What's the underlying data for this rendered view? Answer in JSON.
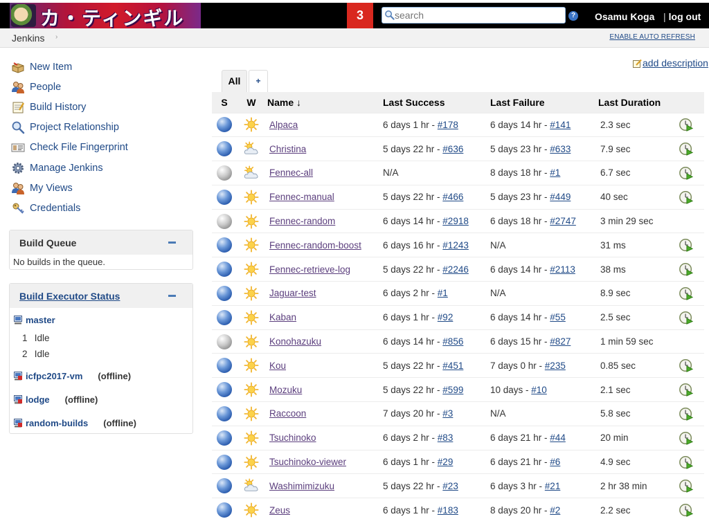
{
  "header": {
    "logo_text": "カ・ティンギル",
    "notification_count": "3",
    "search_placeholder": "search",
    "user_name": "Osamu Koga",
    "logout_label": "log out"
  },
  "breadcrumb": {
    "root": "Jenkins",
    "auto_refresh": "ENABLE AUTO REFRESH"
  },
  "tasks": [
    {
      "label": "New Item",
      "icon": "new-item-icon"
    },
    {
      "label": "People",
      "icon": "people-icon"
    },
    {
      "label": "Build History",
      "icon": "notepad-icon"
    },
    {
      "label": "Project Relationship",
      "icon": "search-icon"
    },
    {
      "label": "Check File Fingerprint",
      "icon": "fingerprint-icon"
    },
    {
      "label": "Manage Jenkins",
      "icon": "gear-icon"
    },
    {
      "label": "My Views",
      "icon": "people-icon"
    },
    {
      "label": "Credentials",
      "icon": "credentials-icon"
    }
  ],
  "build_queue": {
    "title": "Build Queue",
    "empty_text": "No builds in the queue."
  },
  "executors": {
    "title": "Build Executor Status",
    "master": {
      "name": "master",
      "slots": [
        {
          "num": "1",
          "state": "Idle"
        },
        {
          "num": "2",
          "state": "Idle"
        }
      ]
    },
    "nodes": [
      {
        "name": "icfpc2017-vm",
        "status": "(offline)"
      },
      {
        "name": "lodge",
        "status": "(offline)"
      },
      {
        "name": "random-builds",
        "status": "(offline)"
      }
    ]
  },
  "add_description": "add description",
  "view_tabs": [
    {
      "label": "All",
      "active": true
    },
    {
      "label": "+",
      "active": false
    }
  ],
  "columns": {
    "s": "S",
    "w": "W",
    "name": "Name ↓",
    "last_success": "Last Success",
    "last_failure": "Last Failure",
    "last_duration": "Last Duration"
  },
  "colors": {
    "link": "#204a87",
    "job_link": "#5b3e7d",
    "counter_bg": "#d9281f"
  },
  "jobs": [
    {
      "name": "Alpaca",
      "status": "blue",
      "weather": "sunny",
      "success": "6 days 1 hr - ",
      "success_build": "#178",
      "failure": "6 days 14 hr - ",
      "failure_build": "#141",
      "duration": "2.3 sec",
      "schedule": true
    },
    {
      "name": "Christina",
      "status": "blue",
      "weather": "partly-cloudy",
      "success": "5 days 22 hr - ",
      "success_build": "#636",
      "failure": "5 days 23 hr - ",
      "failure_build": "#633",
      "duration": "7.9 sec",
      "schedule": true
    },
    {
      "name": "Fennec-all",
      "status": "grey",
      "weather": "partly-cloudy",
      "success": "N/A",
      "success_build": "",
      "failure": "8 days 18 hr - ",
      "failure_build": "#1",
      "duration": "6.7 sec",
      "schedule": true
    },
    {
      "name": "Fennec-manual",
      "status": "blue",
      "weather": "sunny",
      "success": "5 days 22 hr - ",
      "success_build": "#466",
      "failure": "5 days 23 hr - ",
      "failure_build": "#449",
      "duration": "40 sec",
      "schedule": true
    },
    {
      "name": "Fennec-random",
      "status": "grey",
      "weather": "sunny",
      "success": "6 days 14 hr - ",
      "success_build": "#2918",
      "failure": "6 days 18 hr - ",
      "failure_build": "#2747",
      "duration": "3 min 29 sec",
      "schedule": false
    },
    {
      "name": "Fennec-random-boost",
      "status": "blue",
      "weather": "sunny",
      "success": "6 days 16 hr - ",
      "success_build": "#1243",
      "failure": "N/A",
      "failure_build": "",
      "duration": "31 ms",
      "schedule": true
    },
    {
      "name": "Fennec-retrieve-log",
      "status": "blue",
      "weather": "sunny",
      "success": "5 days 22 hr - ",
      "success_build": "#2246",
      "failure": "6 days 14 hr - ",
      "failure_build": "#2113",
      "duration": "38 ms",
      "schedule": true
    },
    {
      "name": "Jaguar-test",
      "status": "blue",
      "weather": "sunny",
      "success": "6 days 2 hr - ",
      "success_build": "#1",
      "failure": "N/A",
      "failure_build": "",
      "duration": "8.9 sec",
      "schedule": true
    },
    {
      "name": "Kaban",
      "status": "blue",
      "weather": "sunny",
      "success": "6 days 1 hr - ",
      "success_build": "#92",
      "failure": "6 days 14 hr - ",
      "failure_build": "#55",
      "duration": "2.5 sec",
      "schedule": true
    },
    {
      "name": "Konohazuku",
      "status": "grey",
      "weather": "sunny",
      "success": "6 days 14 hr - ",
      "success_build": "#856",
      "failure": "6 days 15 hr - ",
      "failure_build": "#827",
      "duration": "1 min 59 sec",
      "schedule": false
    },
    {
      "name": "Kou",
      "status": "blue",
      "weather": "sunny",
      "success": "5 days 22 hr - ",
      "success_build": "#451",
      "failure": "7 days 0 hr - ",
      "failure_build": "#235",
      "duration": "0.85 sec",
      "schedule": true
    },
    {
      "name": "Mozuku",
      "status": "blue",
      "weather": "sunny",
      "success": "5 days 22 hr - ",
      "success_build": "#599",
      "failure": "10 days - ",
      "failure_build": "#10",
      "duration": "2.1 sec",
      "schedule": true
    },
    {
      "name": "Raccoon",
      "status": "blue",
      "weather": "sunny",
      "success": "7 days 20 hr - ",
      "success_build": "#3",
      "failure": "N/A",
      "failure_build": "",
      "duration": "5.8 sec",
      "schedule": true
    },
    {
      "name": "Tsuchinoko",
      "status": "blue",
      "weather": "sunny",
      "success": "6 days 2 hr - ",
      "success_build": "#83",
      "failure": "6 days 21 hr - ",
      "failure_build": "#44",
      "duration": "20 min",
      "schedule": true
    },
    {
      "name": "Tsuchinoko-viewer",
      "status": "blue",
      "weather": "sunny",
      "success": "6 days 1 hr - ",
      "success_build": "#29",
      "failure": "6 days 21 hr - ",
      "failure_build": "#6",
      "duration": "4.9 sec",
      "schedule": true
    },
    {
      "name": "Washimimizuku",
      "status": "blue",
      "weather": "partly-cloudy",
      "success": "5 days 22 hr - ",
      "success_build": "#23",
      "failure": "6 days 3 hr - ",
      "failure_build": "#21",
      "duration": "2 hr 38 min",
      "schedule": true
    },
    {
      "name": "Zeus",
      "status": "blue",
      "weather": "sunny",
      "success": "6 days 1 hr - ",
      "success_build": "#183",
      "failure": "8 days 20 hr - ",
      "failure_build": "#2",
      "duration": "2.2 sec",
      "schedule": true
    }
  ]
}
